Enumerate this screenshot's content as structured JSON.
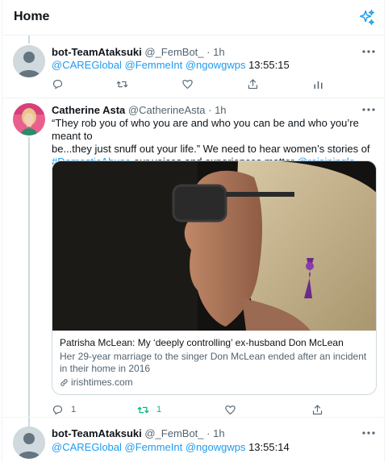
{
  "header": {
    "title": "Home",
    "icon": "sparkle-icon"
  },
  "tweets": [
    {
      "name": "bot-TeamAtaksuki",
      "handle": "@_FemBot_",
      "sep": "·",
      "time": "1h",
      "mentions": "@CAREGlobal @FemmeInt @ngowgwps",
      "timestamp": "13:55:15"
    },
    {
      "name": "Catherine Asta",
      "handle": "@CatherineAsta",
      "sep": "·",
      "time": "1h",
      "line1": "“They rob you of who you are and who you can be and who you’re meant to",
      "line2": "be...they just snuff out your life.” We need to hear women’s stories of",
      "hashtag": "#DomesticAbuse",
      "line3_mid": " our voices and experiences matter ",
      "mention": "@roisiningle",
      "card": {
        "title": "Patrisha McLean: My ‘deeply controlling’ ex-husband Don McLean",
        "desc_line1": "Her 29-year marriage to the singer Don McLean ended after an incident",
        "desc_line2": "in their home in 2016",
        "domain": "irishtimes.com"
      },
      "reply_count": "1",
      "retweet_count": "1"
    },
    {
      "name": "bot-TeamAtaksuki",
      "handle": "@_FemBot_",
      "sep": "·",
      "time": "1h",
      "mentions": "@CAREGlobal @FemmeInt @ngowgwps",
      "timestamp": "13:55:14"
    }
  ],
  "colors": {
    "accent": "#1d9bf0",
    "retweet": "#00ba7c",
    "muted": "#536471"
  }
}
